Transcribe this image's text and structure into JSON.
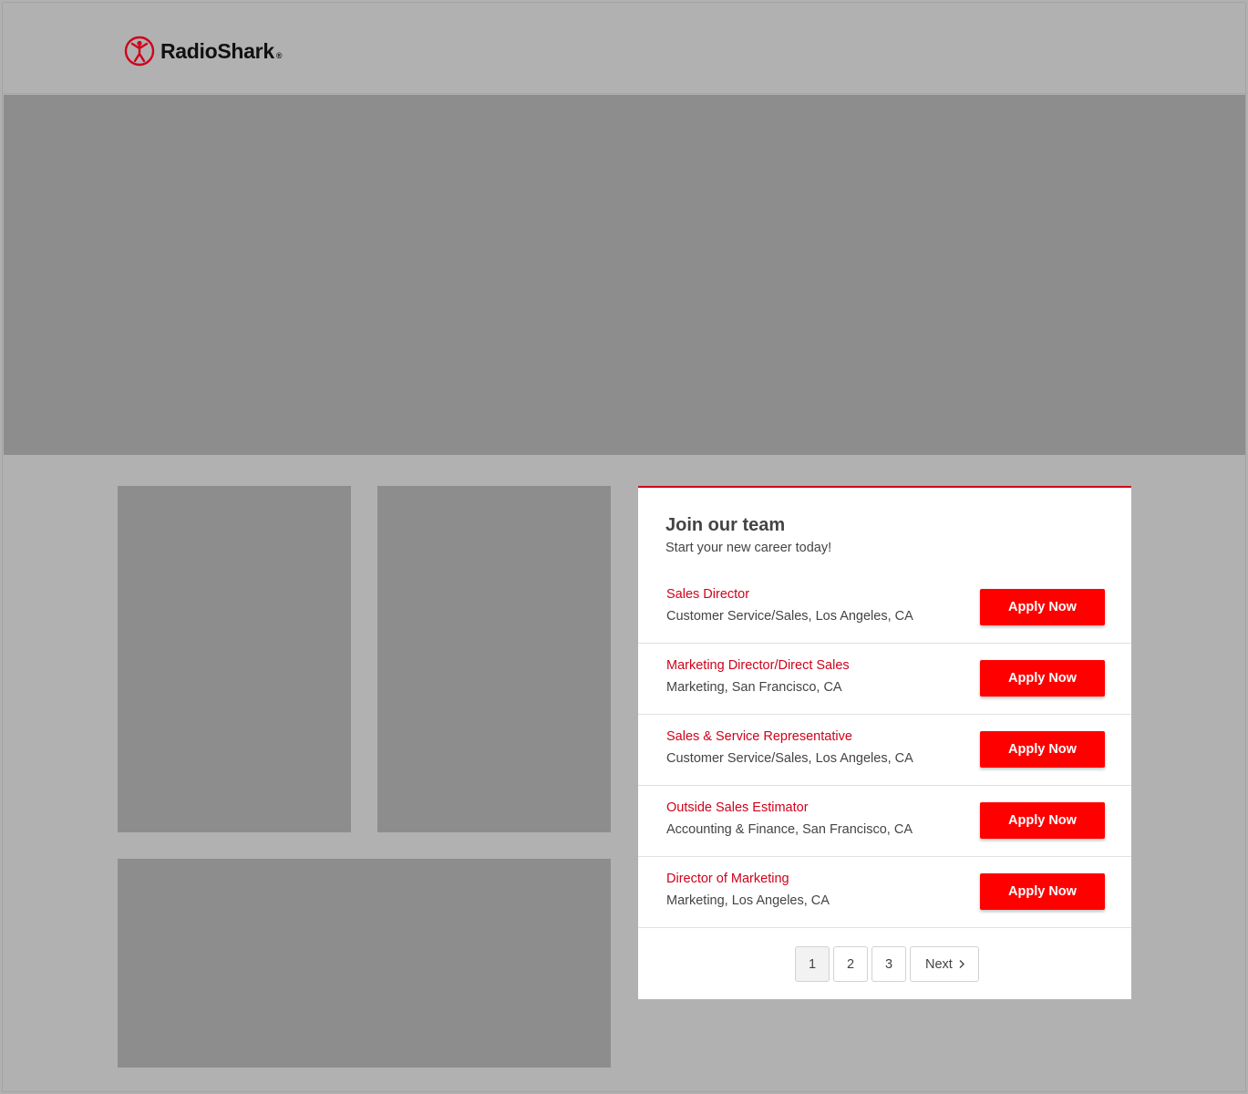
{
  "brand": {
    "name": "RadioShark",
    "registered": "®",
    "accent": "#d0021b",
    "button_color": "#ff0000"
  },
  "careers": {
    "title": "Join our team",
    "subtitle": "Start your new career today!",
    "jobs": [
      {
        "title": "Sales Director",
        "meta": "Customer Service/Sales, Los Angeles, CA",
        "apply": "Apply Now"
      },
      {
        "title": "Marketing Director/Direct Sales",
        "meta": "Marketing, San Francisco, CA",
        "apply": "Apply Now"
      },
      {
        "title": "Sales & Service Representative",
        "meta": "Customer Service/Sales, Los Angeles, CA",
        "apply": "Apply Now"
      },
      {
        "title": "Outside Sales Estimator",
        "meta": "Accounting & Finance, San Francisco, CA",
        "apply": "Apply Now"
      },
      {
        "title": "Director of Marketing",
        "meta": "Marketing, Los Angeles, CA",
        "apply": "Apply Now"
      }
    ],
    "pagination": {
      "pages": [
        "1",
        "2",
        "3"
      ],
      "current": "1",
      "next": "Next",
      "next_icon": "chevron-right-icon"
    }
  }
}
